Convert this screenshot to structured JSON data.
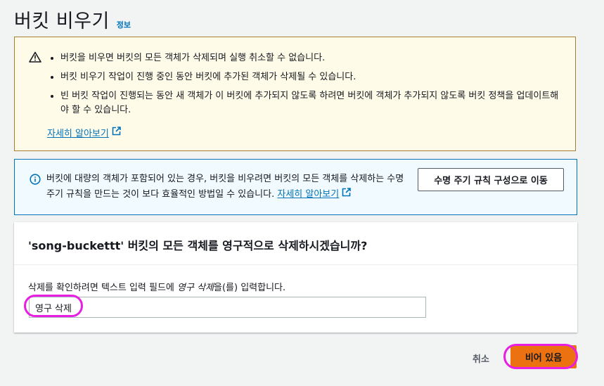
{
  "header": {
    "title": "버킷 비우기",
    "info_link": "정보"
  },
  "warning": {
    "items": [
      "버킷을 비우면 버킷의 모든 객체가 삭제되며 실행 취소할 수 없습니다.",
      "버킷 비우기 작업이 진행 중인 동안 버킷에 추가된 객체가 삭제될 수 있습니다.",
      "빈 버킷 작업이 진행되는 동안 새 객체가 이 버킷에 추가되지 않도록 하려면 버킷에 객체가 추가되지 않도록 버킷 정책을 업데이트해야 할 수 있습니다."
    ],
    "learn_more": "자세히 알아보기",
    "icon": "warning-triangle-icon"
  },
  "info": {
    "text": "버킷에 대량의 객체가 포함되어 있는 경우, 버킷을 비우려면 버킷의 모든 객체를 삭제하는 수명 주기 규칙을 만드는 것이 보다 효율적인 방법일 수 있습니다.",
    "learn_more": "자세히 알아보기",
    "button_label": "수명 주기 규칙 구성으로 이동",
    "icon": "info-circle-icon"
  },
  "confirm_panel": {
    "title": "'song-buckettt' 버킷의 모든 객체를 영구적으로 삭제하시겠습니까?",
    "label_prefix": "삭제를 확인하려면 텍스트 입력 필드에 ",
    "label_emphasis": "영구 삭제",
    "label_suffix": "을(를) 입력합니다.",
    "input_value": "영구 삭제"
  },
  "footer": {
    "cancel_label": "취소",
    "submit_label": "비어 있음"
  },
  "colors": {
    "warning_bg": "#fffbe9",
    "warning_border": "#a77e2d",
    "info_bg": "#f1faff",
    "info_border": "#0073bb",
    "primary_button": "#ec7211",
    "link": "#0073bb",
    "annotation_highlight": "#e81ee3"
  }
}
